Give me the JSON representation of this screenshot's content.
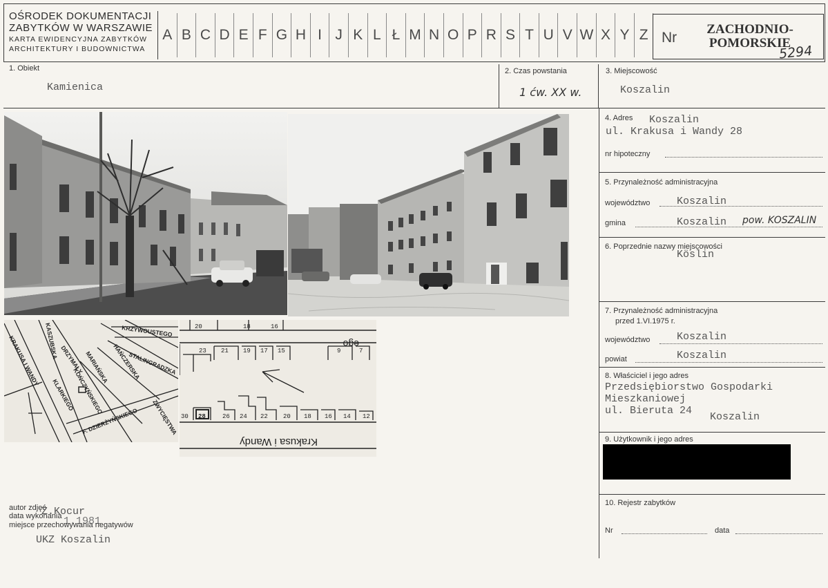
{
  "header": {
    "institution_line1": "OŚRODEK DOKUMENTACJI",
    "institution_line2": "ZABYTKÓW W WARSZAWIE",
    "institution_line3": "KARTA EWIDENCYJNA ZABYTKÓW",
    "institution_line4": "ARCHITEKTURY I BUDOWNICTWA",
    "letters": [
      "A",
      "B",
      "C",
      "D",
      "E",
      "F",
      "G",
      "H",
      "I",
      "J",
      "K",
      "L",
      "Ł",
      "M",
      "N",
      "O",
      "P",
      "R",
      "S",
      "T",
      "U",
      "V",
      "W",
      "X",
      "Y",
      "Z"
    ],
    "nr_label": "Nr",
    "region_line1": "ZACHODNIO-",
    "region_line2": "POMORSKIE",
    "nr_value": "5294"
  },
  "fields": {
    "obiekt_label": "1. Obiekt",
    "obiekt_value": "Kamienica",
    "czas_label": "2. Czas powstania",
    "czas_value": "1 ćw. XX w.",
    "miejscowosc_label": "3. Miejscowość",
    "miejscowosc_value": "Koszalin",
    "adres_label": "4. Adres",
    "adres_value1": "Koszalin",
    "adres_value2": "ul. Krakusa i Wandy 28",
    "hipoteczny_label": "nr hipoteczny",
    "przyn_label": "5. Przynależność administracyjna",
    "woj_label": "województwo",
    "woj_value": "Koszalin",
    "gmina_label": "gmina",
    "gmina_value": "Koszalin",
    "gmina_note": "pow. KOSZALIN",
    "poprz_label": "6. Poprzednie nazwy miejscowości",
    "poprz_value": "Köslin",
    "przyn75_label1": "7. Przynależność administracyjna",
    "przyn75_label2": "przed 1.VI.1975 r.",
    "woj75_label": "województwo",
    "woj75_value": "Koszalin",
    "powiat_label": "powiat",
    "powiat_value": "Koszalin",
    "wlasc_label": "8. Właściciel i jego adres",
    "wlasc_value1": "Przedsiębiorstwo Gospodarki",
    "wlasc_value2": "Mieszkaniowej",
    "wlasc_value3": "ul. Bieruta  24",
    "wlasc_value4": "Koszalin",
    "uzyt_label": "9. Użytkownik i jego adres",
    "rejestr_label": "10. Rejestr zabytków",
    "nr_label": "Nr",
    "data_label": "data"
  },
  "footer": {
    "autor_label": "autor zdjęć",
    "autor_value": "Z.Kocur",
    "data_label": "data wykonania",
    "data_value": "1.1981",
    "miejsce_label": "miejsce przechowywania negatywów",
    "miejsce_value": "UKZ Koszalin"
  },
  "map": {
    "streets": [
      "KASZUBSKA",
      "KRAKUSA I WANDY",
      "DRZYMAŁY",
      "MARIAŃSKA",
      "HAŃCZERSKA",
      "STALINGRADZKA",
      "KRZYWOUSTEGO",
      "KOŃCZYŃSKIEGO",
      "F. DZIERŻYŃSKIEGO",
      "KLARKIEGO",
      "ZWYCIĘSTWA"
    ],
    "plan_top_numbers": [
      "20",
      "18",
      "16"
    ],
    "plan_row1": [
      "23",
      "21",
      "19",
      "17",
      "15",
      "9",
      "7"
    ],
    "plan_row2": [
      "30",
      "28",
      "26",
      "24",
      "22",
      "20",
      "18",
      "16",
      "14",
      "12"
    ],
    "plan_street": "Krakusa i Wandy",
    "plan_top_street": "ego"
  }
}
